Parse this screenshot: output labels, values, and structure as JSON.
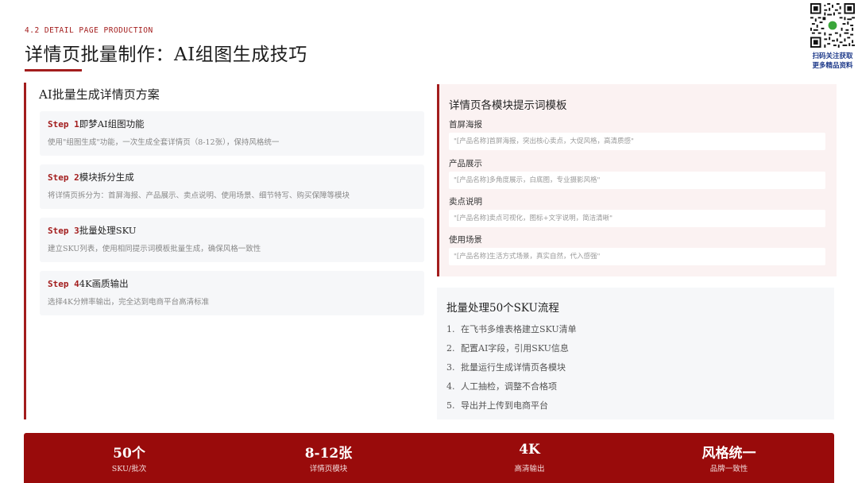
{
  "header": {
    "section_tag": "4.2 DETAIL PAGE PRODUCTION",
    "title": "详情页批量制作：AI组图生成技巧"
  },
  "qr": {
    "caption_line1": "扫码关注获取",
    "caption_line2": "更多精品资料"
  },
  "left": {
    "heading": "AI批量生成详情页方案",
    "steps": [
      {
        "num": "Step 1",
        "title": "即梦AI组图功能",
        "desc": "使用\"组图生成\"功能，一次生成全套详情页（8-12张），保持风格统一"
      },
      {
        "num": "Step 2",
        "title": "模块拆分生成",
        "desc": "将详情页拆分为：首屏海报、产品展示、卖点说明、使用场景、细节特写、购买保障等模块"
      },
      {
        "num": "Step 3",
        "title": "批量处理SKU",
        "desc": "建立SKU列表，使用相同提示词模板批量生成，确保风格一致性"
      },
      {
        "num": "Step 4",
        "title": "4K画质输出",
        "desc": "选择4K分辨率输出，完全达到电商平台高清标准"
      }
    ]
  },
  "templates": {
    "heading": "详情页各模块提示词模板",
    "items": [
      {
        "label": "首屏海报",
        "prompt": "\"[产品名称]首屏海报，突出核心卖点，大促风格，高清质感\""
      },
      {
        "label": "产品展示",
        "prompt": "\"[产品名称]多角度展示，白底图，专业摄影风格\""
      },
      {
        "label": "卖点说明",
        "prompt": "\"[产品名称]卖点可视化，图标+文字说明，简洁清晰\""
      },
      {
        "label": "使用场景",
        "prompt": "\"[产品名称]生活方式场景，真实自然，代入感强\""
      }
    ]
  },
  "flow": {
    "heading": "批量处理50个SKU流程",
    "items": [
      {
        "num": "1.",
        "text": "在飞书多维表格建立SKU清单"
      },
      {
        "num": "2.",
        "text": "配置AI字段，引用SKU信息"
      },
      {
        "num": "3.",
        "text": "批量运行生成详情页各模块"
      },
      {
        "num": "4.",
        "text": "人工抽检，调整不合格项"
      },
      {
        "num": "5.",
        "text": "导出并上传到电商平台"
      }
    ]
  },
  "stats": [
    {
      "value": "50个",
      "label": "SKU/批次"
    },
    {
      "value": "8-12张",
      "label": "详情页模块"
    },
    {
      "value": "4K",
      "label": "高清输出"
    },
    {
      "value": "风格统一",
      "label": "品牌一致性"
    }
  ],
  "colors": {
    "accent": "#a31d1d",
    "stats_bar": "#990b0b",
    "template_bg": "#fbf2f2",
    "card_bg": "#f6f7f9"
  }
}
